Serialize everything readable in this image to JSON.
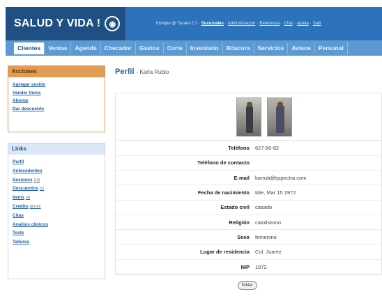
{
  "header": {
    "logo_text": "SALUD Y VIDA !",
    "logo_icon": "globe-icon",
    "user_label": "Enrique @ Tijuana C1",
    "links": [
      "Sucursales",
      "Administración",
      "Referencia",
      "Chat",
      "Ayuda",
      "Salir"
    ]
  },
  "nav": {
    "tabs": [
      "Clientes",
      "Ventas",
      "Agenda",
      "Checador",
      "Gastos",
      "Corte",
      "Inventario",
      "Bitacora",
      "Servicios",
      "Avisos",
      "Personal"
    ],
    "active": "Clientes"
  },
  "acciones": {
    "title": "Acciones",
    "items": [
      "Agregar sesión",
      "Vender items",
      "Abonar",
      "Dar descuento"
    ]
  },
  "links": {
    "title": "Links",
    "items": [
      {
        "label": "Perfil",
        "count": ""
      },
      {
        "label": "Antecedentes",
        "count": ""
      },
      {
        "label": "Sesiones",
        "count": "(10)"
      },
      {
        "label": "Descuentos",
        "count": "(1)"
      },
      {
        "label": "Items",
        "count": "(4)"
      },
      {
        "label": "Crédito",
        "count": "($0.00)"
      },
      {
        "label": "Citas",
        "count": ""
      },
      {
        "label": "Analisis clinicos",
        "count": ""
      },
      {
        "label": "Tests",
        "count": ""
      },
      {
        "label": "Talleres",
        "count": ""
      }
    ]
  },
  "profile": {
    "title": "Perfil",
    "name": "Karla Rubio",
    "fields": [
      {
        "label": "Teléfono",
        "value": "627-50-82"
      },
      {
        "label": "Teléfono de contacto",
        "value": ""
      },
      {
        "label": "E-mail",
        "value": "karrub@tjspectra.com"
      },
      {
        "label": "Fecha de nacimiento",
        "value": "Mie, Mar 15 1972"
      },
      {
        "label": "Estado civil",
        "value": "casado"
      },
      {
        "label": "Religión",
        "value": "catolisismo"
      },
      {
        "label": "Sexo",
        "value": "femenino"
      },
      {
        "label": "Lugar de residencia",
        "value": "Col. Juarez"
      },
      {
        "label": "NIP",
        "value": "1972"
      }
    ],
    "edit_label": "Editar"
  }
}
